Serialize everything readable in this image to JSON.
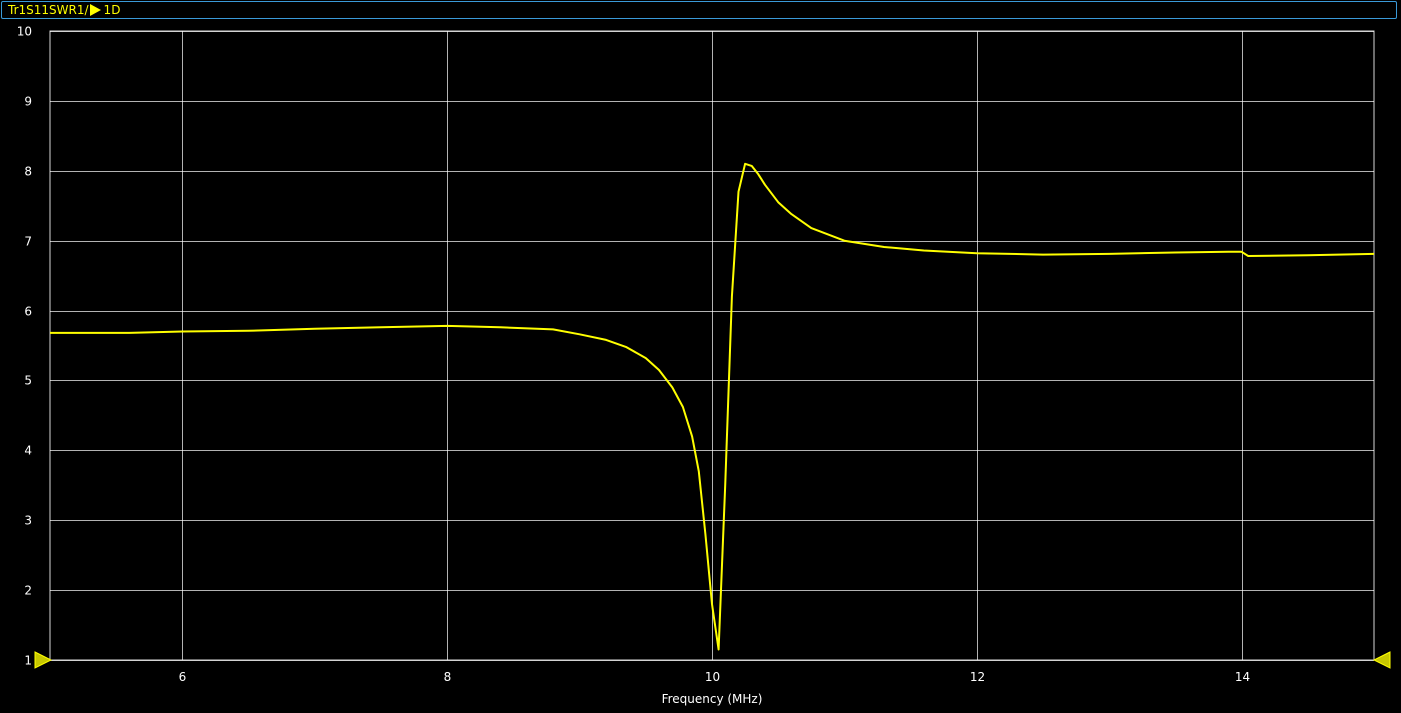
{
  "header": {
    "trace": "Tr1",
    "parameter": "S11",
    "format": "SWR",
    "scale": "1/",
    "ref_marker": "1",
    "suffix": "D",
    "border_color": "#3a9ad9",
    "text_color": "#ffff00"
  },
  "chart_data": {
    "type": "line",
    "title": "",
    "xlabel": "Frequency (MHz)",
    "ylabel": "",
    "xlim": [
      5,
      15
    ],
    "ylim": [
      1,
      10
    ],
    "x_ticks": [
      6,
      8,
      10,
      12,
      14
    ],
    "y_ticks": [
      1,
      2,
      3,
      4,
      5,
      6,
      7,
      8,
      9,
      10
    ],
    "grid": true,
    "trace_color": "#ffff00",
    "grid_color": "#ffffff",
    "background": "#000000",
    "reference_markers": [
      {
        "side": "left",
        "value": 1
      },
      {
        "side": "right",
        "value": 1
      }
    ],
    "series": [
      {
        "x": [
          5.0,
          5.3,
          5.6,
          6.0,
          6.5,
          7.0,
          7.5,
          8.0,
          8.4,
          8.8,
          9.0,
          9.2,
          9.35,
          9.5,
          9.6,
          9.7,
          9.78,
          9.85,
          9.9,
          9.95,
          10.0,
          10.05,
          10.1,
          10.15,
          10.2,
          10.25,
          10.3,
          10.35,
          10.4,
          10.5,
          10.6,
          10.75,
          11.0,
          11.3,
          11.6,
          12.0,
          12.5,
          13.0,
          13.5,
          13.9,
          14.0,
          14.05,
          14.5,
          15.0
        ],
        "y": [
          5.68,
          5.68,
          5.68,
          5.7,
          5.71,
          5.74,
          5.76,
          5.78,
          5.76,
          5.73,
          5.66,
          5.58,
          5.48,
          5.32,
          5.15,
          4.9,
          4.62,
          4.2,
          3.7,
          2.8,
          1.8,
          1.15,
          3.5,
          6.2,
          7.7,
          8.1,
          8.07,
          7.95,
          7.8,
          7.55,
          7.38,
          7.18,
          7.0,
          6.91,
          6.86,
          6.82,
          6.8,
          6.81,
          6.83,
          6.84,
          6.84,
          6.78,
          6.79,
          6.81
        ]
      }
    ]
  }
}
